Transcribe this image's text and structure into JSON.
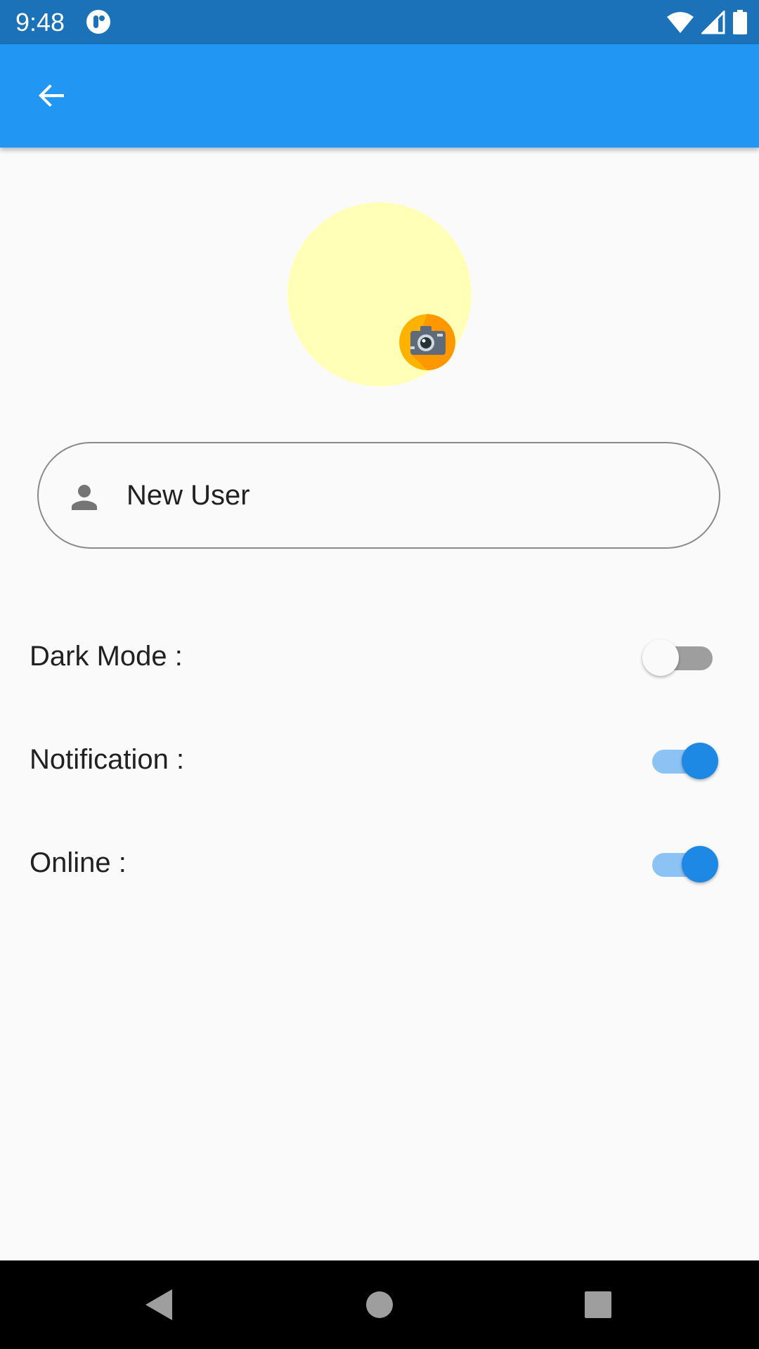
{
  "status_bar": {
    "time": "9:48",
    "icons": [
      "app-notification-icon",
      "wifi-icon",
      "cell-signal-icon",
      "battery-icon"
    ]
  },
  "app_bar": {
    "back_icon": "arrow-left-icon"
  },
  "profile": {
    "avatar_color": "#ffffb8",
    "camera_icon": "camera-icon"
  },
  "name_field": {
    "icon": "person-icon",
    "value": "New User"
  },
  "settings": {
    "dark_mode": {
      "label": "Dark Mode :",
      "enabled": false
    },
    "notification": {
      "label": "Notification :",
      "enabled": true
    },
    "online": {
      "label": "Online :",
      "enabled": true
    }
  },
  "colors": {
    "status_bar": "#1b72b8",
    "app_bar": "#2196f3",
    "switch_on": "#1e88e5",
    "background": "#fafafa"
  },
  "nav_bar": {
    "buttons": [
      "back-triangle-icon",
      "home-circle-icon",
      "recents-square-icon"
    ]
  }
}
